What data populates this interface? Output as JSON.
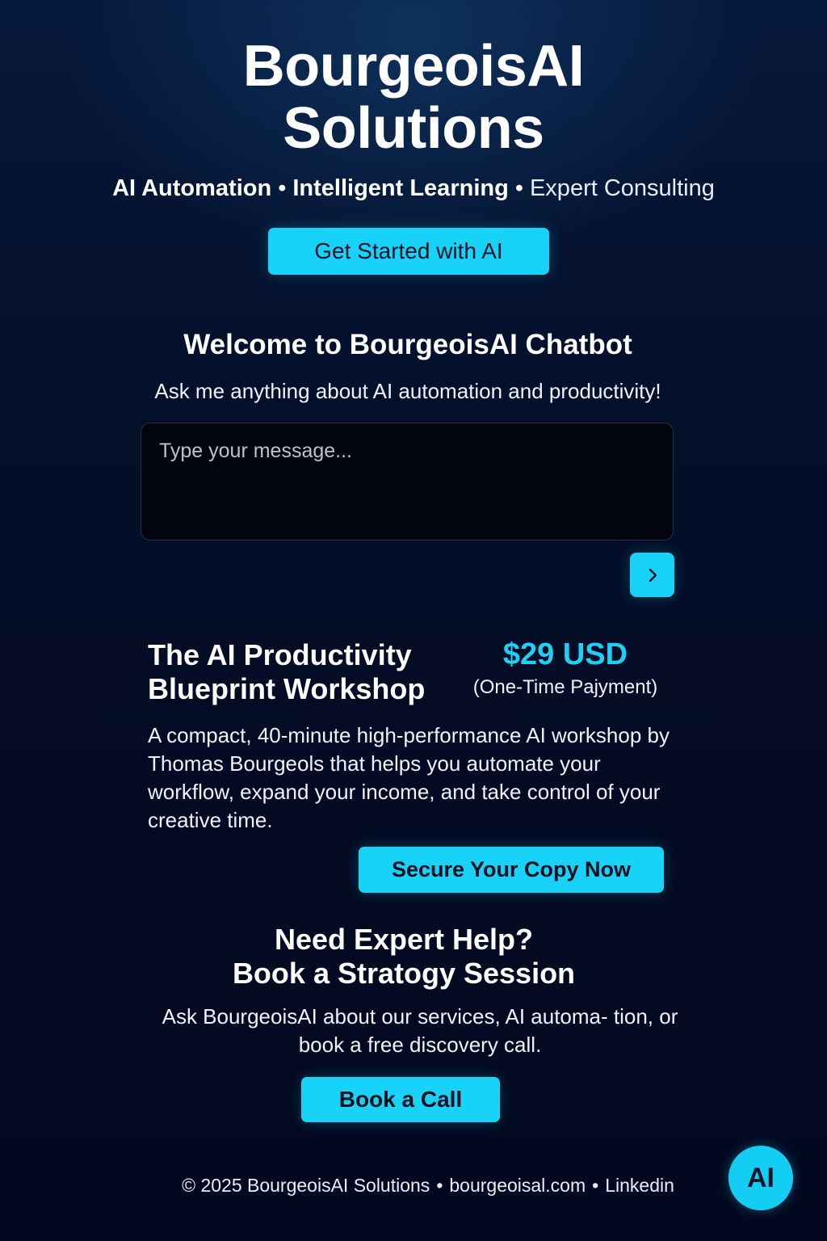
{
  "hero": {
    "title_line1": "BourgeoisAI",
    "title_line2": "Solutions",
    "tagline": {
      "item1": "AI Automation",
      "item2": "Intelligent Learning",
      "item3": "Expert Consulting",
      "separator": "•"
    },
    "cta_label": "Get Started with AI"
  },
  "chatbot": {
    "title": "Welcome to BourgeoisAI Chatbot",
    "subtitle": "Ask me anything about AI automation and productivity!",
    "input_placeholder": "Type your message...",
    "input_value": "",
    "send_icon": "chevron-right-icon"
  },
  "workshop": {
    "title_line1": "The AI Productivity",
    "title_line2": "Blueprint Workshop",
    "price": "$29 USD",
    "price_note": "(One-Time Pajyment)",
    "description": "A compact, 40-minute high-performance AI workshop by Thomas Bourgeols that helps you automate your workflow, expand your income, and take control of your creative time.",
    "cta_label": "Secure Your Copy Now"
  },
  "strategy": {
    "title_line1": "Need Expert Help?",
    "title_line2": "Book a Stratogy Session",
    "description": "Ask BourgeoisAI about our services, AI automa- tion, or book a free discovery call.",
    "cta_label": "Book a Call"
  },
  "footer": {
    "copyright": "© 2025 BourgeoisAI Solutions",
    "website": "bourgeoisal.com",
    "linkedin": "Linkedin",
    "separator": "•",
    "badge_label": "AI"
  },
  "colors": {
    "accent": "#18d3f7",
    "background": "#030a22",
    "text": "#ffffff"
  }
}
